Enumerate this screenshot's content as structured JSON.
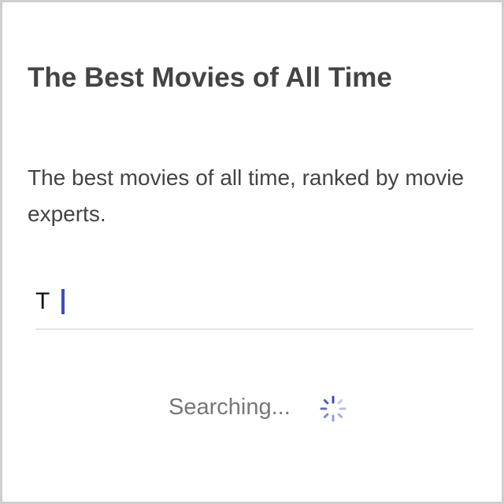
{
  "page": {
    "title": "The Best Movies of All Time",
    "description": "The best movies of all time, ranked by movie experts."
  },
  "search": {
    "value": "T",
    "status_text": "Searching..."
  },
  "icons": {
    "spinner": "loading-spinner-icon"
  },
  "colors": {
    "title": "#444444",
    "caret": "#3b4cc0",
    "spinner": "#3b4cc0",
    "status_text": "#777777",
    "frame_border": "#cfcfcf",
    "underline": "#e6e6e6"
  }
}
